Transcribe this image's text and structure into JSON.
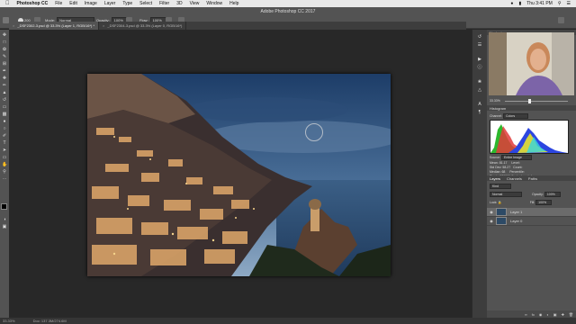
{
  "menubar": {
    "app": "Photoshop CC",
    "items": [
      "File",
      "Edit",
      "Image",
      "Layer",
      "Type",
      "Select",
      "Filter",
      "3D",
      "View",
      "Window",
      "Help"
    ],
    "clock": "Thu 3:41 PM"
  },
  "window_title": "Adobe Photoshop CC 2017",
  "options": {
    "brush_size": "200",
    "mode_label": "Mode:",
    "mode_value": "Normal",
    "opacity_label": "Opacity:",
    "opacity_value": "100%",
    "flow_label": "Flow:",
    "flow_value": "100%"
  },
  "tabs": [
    {
      "label": "_DSF2302-3.psd @ 33.3% (Layer 1, RGB/16*) *",
      "active": true
    },
    {
      "label": "_DSF2304-3.psd @ 33.3% (Layer 0, RGB/16*)",
      "active": false
    }
  ],
  "panels": {
    "navigator": "Navigator",
    "histogram": "Histogram",
    "channel_label": "Channel:",
    "channel_value": "Colors",
    "source_label": "Source:",
    "source_value": "Entire Image",
    "stats": {
      "mean_label": "Mean:",
      "mean": "81.17",
      "stddev_label": "Std Dev:",
      "stddev": "58.27",
      "median_label": "Median:",
      "median": "68",
      "pixels_label": "Pixels:",
      "pixels": "276000",
      "level_label": "Level:",
      "count_label": "Count:",
      "percentile_label": "Percentile:",
      "cache_label": "Cache Level:",
      "cache": "4"
    },
    "zoom": "33.33%",
    "layer_tabs": [
      "Layers",
      "Channels",
      "Paths"
    ],
    "kind_label": "Kind",
    "blend": "Normal",
    "opacity_label": "Opacity:",
    "opacity": "100%",
    "lock_label": "Lock:",
    "fill_label": "Fill:",
    "fill": "100%",
    "layers": [
      {
        "name": "Layer 1",
        "selected": true
      },
      {
        "name": "Layer 0",
        "selected": false
      }
    ]
  },
  "status": {
    "zoom": "33.33%",
    "doc": "Doc: 137.3M/274.6M"
  },
  "colors": {
    "accent": "#0a84ff",
    "panel": "#535353",
    "canvas": "#282828"
  }
}
